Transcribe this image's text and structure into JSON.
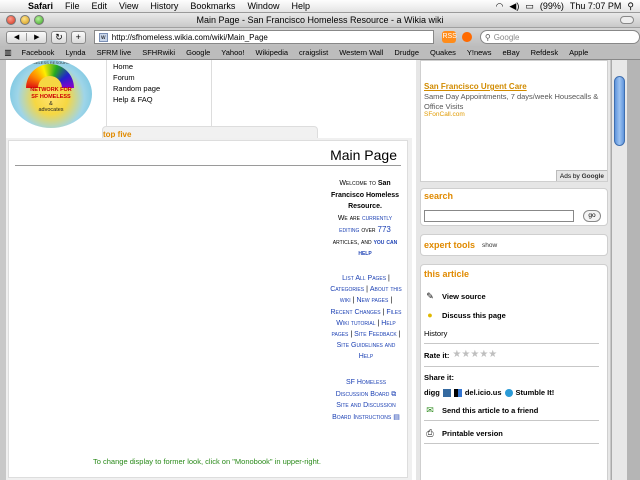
{
  "menubar": {
    "apple_glyph": "",
    "app_name": "Safari",
    "menus": [
      "File",
      "Edit",
      "View",
      "History",
      "Bookmarks",
      "Window",
      "Help"
    ],
    "battery": "(99%)",
    "clock": "Thu 7:07 PM"
  },
  "window": {
    "title": "Main Page - San Francisco Homeless Resource - a Wikia wiki"
  },
  "toolbar": {
    "back_glyph": "◀",
    "forward_glyph": "▶",
    "reload_glyph": "↻",
    "add_glyph": "+",
    "url": "http://sfhomeless.wikia.com/wiki/Main_Page",
    "rss_label": "RSS",
    "search_placeholder": "Google"
  },
  "bookmarks": [
    "Facebook",
    "Lynda",
    "SFRM live",
    "SFHRwiki",
    "Google",
    "Yahoo!",
    "Wikipedia",
    "craigslist",
    "Western Wall",
    "Drudge",
    "Quakes",
    "Y!news",
    "eBay",
    "Refdesk",
    "Apple"
  ],
  "sidebar": {
    "logo_tagline": "SF HOMELESS RESOURCE NET",
    "logo_lines": [
      "NETWORK FOR",
      "SF HOMELESS",
      "&",
      "advocates"
    ],
    "nav": [
      "Home",
      "Forum",
      "Random page",
      "Help & FAQ"
    ],
    "top_five": "top five"
  },
  "article": {
    "title": "Main Page",
    "welcome_a": "Welcome to",
    "site_name": "San Francisco Homeless Resource.",
    "we_are": "We are",
    "currently_editing": "currently editing",
    "over": "over",
    "article_count": "773",
    "articles_and": "articles, and",
    "you_can_help": "you can help",
    "links": [
      "List All Pages",
      "Categories",
      "About this wiki",
      "New pages",
      "Recent Changes",
      "Files",
      "Wiki tutorial",
      "Help pages",
      "Site Feedback",
      "Site Guidelines and Help"
    ],
    "discussion": [
      "SF Homeless Discussion Board",
      "Site and Discussion Board Instructions"
    ],
    "footer_note": "To change display to former look, click on \"Monobook\" in upper-right."
  },
  "rail": {
    "ad_title": "San Francisco Urgent Care",
    "ad_text": "Same Day Appointments, 7 days/week Housecalls & Office Visits",
    "ad_url": "SFonCall.com",
    "ads_by_prefix": "Ads by",
    "ads_by_brand": "Google",
    "search_heading": "search",
    "search_go": "go",
    "expert_heading": "expert tools",
    "expert_show": "show",
    "this_article_heading": "this article",
    "view_source": "View source",
    "discuss_page": "Discuss this page",
    "history": "History",
    "rate_label": "Rate it:",
    "rating": 0,
    "rating_max": 5,
    "share_label": "Share it:",
    "share_digg": "digg",
    "share_delicious": "del.icio.us",
    "share_stumble": "Stumble It!",
    "send_article": "Send this article to a friend",
    "printable": "Printable version"
  },
  "colors": {
    "accent_orange": "#e08a00",
    "link_blue": "#1a3fb3",
    "note_green": "#2a8a1a"
  }
}
